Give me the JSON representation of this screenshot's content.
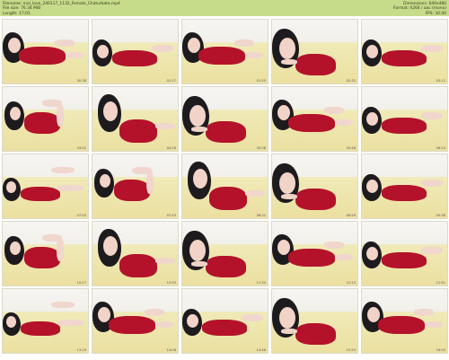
{
  "header": {
    "filename": "Filename: moi_love_240117_1132_Female_Chaturbate.mp4",
    "filesize": "File size: 76.34 MiB",
    "length": "Length: 17:01",
    "dimensions": "Dimensions: 640x480",
    "format": "Format: h264 / aac (mono)",
    "fps": "FPS: 30.00"
  },
  "frames": [
    {
      "timestamp": "00:38",
      "variant": 0
    },
    {
      "timestamp": "01:17",
      "variant": 1
    },
    {
      "timestamp": "01:55",
      "variant": 0
    },
    {
      "timestamp": "02:32",
      "variant": 2
    },
    {
      "timestamp": "03:12",
      "variant": 1
    },
    {
      "timestamp": "03:51",
      "variant": 3
    },
    {
      "timestamp": "04:28",
      "variant": 4
    },
    {
      "timestamp": "05:08",
      "variant": 2
    },
    {
      "timestamp": "05:46",
      "variant": 0
    },
    {
      "timestamp": "06:24",
      "variant": 1
    },
    {
      "timestamp": "07:03",
      "variant": 5
    },
    {
      "timestamp": "07:43",
      "variant": 3
    },
    {
      "timestamp": "08:21",
      "variant": 4
    },
    {
      "timestamp": "08:59",
      "variant": 2
    },
    {
      "timestamp": "09:38",
      "variant": 1
    },
    {
      "timestamp": "10:17",
      "variant": 3
    },
    {
      "timestamp": "10:55",
      "variant": 4
    },
    {
      "timestamp": "11:34",
      "variant": 2
    },
    {
      "timestamp": "12:13",
      "variant": 0
    },
    {
      "timestamp": "12:51",
      "variant": 1
    },
    {
      "timestamp": "13:29",
      "variant": 5
    },
    {
      "timestamp": "14:08",
      "variant": 0
    },
    {
      "timestamp": "14:46",
      "variant": 1
    },
    {
      "timestamp": "15:25",
      "variant": 2
    },
    {
      "timestamp": "16:03",
      "variant": 0
    }
  ]
}
